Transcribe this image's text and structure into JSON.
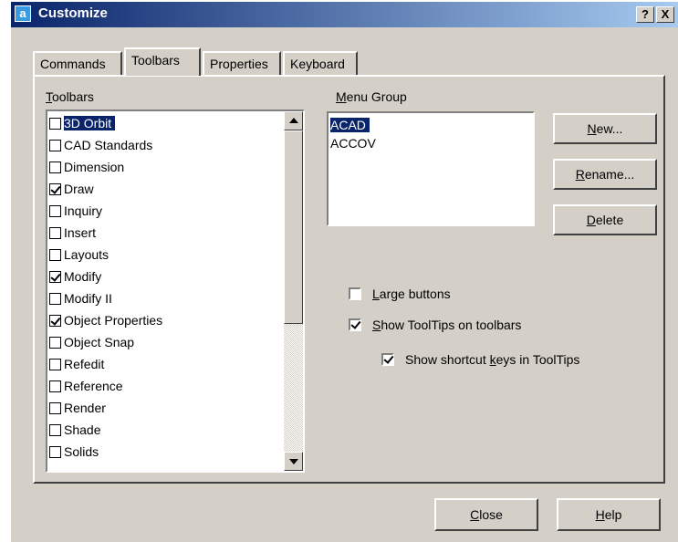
{
  "window": {
    "title": "Customize",
    "app_icon_glyph": "a",
    "help_glyph": "?",
    "close_glyph": "X"
  },
  "tabs": [
    {
      "label": "Commands",
      "active": false
    },
    {
      "label": "Toolbars",
      "active": true
    },
    {
      "label": "Properties",
      "active": false
    },
    {
      "label": "Keyboard",
      "active": false
    }
  ],
  "toolbars": {
    "label_key": "T",
    "label_rest": "oolbars",
    "items": [
      {
        "label": "3D Orbit",
        "checked": false,
        "selected": true
      },
      {
        "label": "CAD Standards",
        "checked": false,
        "selected": false
      },
      {
        "label": "Dimension",
        "checked": false,
        "selected": false
      },
      {
        "label": "Draw",
        "checked": true,
        "selected": false
      },
      {
        "label": "Inquiry",
        "checked": false,
        "selected": false
      },
      {
        "label": "Insert",
        "checked": false,
        "selected": false
      },
      {
        "label": "Layouts",
        "checked": false,
        "selected": false
      },
      {
        "label": "Modify",
        "checked": true,
        "selected": false
      },
      {
        "label": "Modify II",
        "checked": false,
        "selected": false
      },
      {
        "label": "Object Properties",
        "checked": true,
        "selected": false
      },
      {
        "label": "Object Snap",
        "checked": false,
        "selected": false
      },
      {
        "label": "Refedit",
        "checked": false,
        "selected": false
      },
      {
        "label": "Reference",
        "checked": false,
        "selected": false
      },
      {
        "label": "Render",
        "checked": false,
        "selected": false
      },
      {
        "label": "Shade",
        "checked": false,
        "selected": false
      },
      {
        "label": "Solids",
        "checked": false,
        "selected": false
      }
    ]
  },
  "menu_group": {
    "label_key": "M",
    "label_rest": "enu Group",
    "items": [
      {
        "label": "ACAD",
        "selected": true
      },
      {
        "label": "ACCOV",
        "selected": false
      }
    ]
  },
  "buttons": {
    "new": {
      "key": "N",
      "rest": "ew..."
    },
    "rename": {
      "key": "R",
      "rest": "ename..."
    },
    "delete": {
      "key": "D",
      "rest": "elete"
    },
    "close": {
      "key": "C",
      "rest": "lose"
    },
    "help": {
      "key": "H",
      "rest": "elp"
    }
  },
  "options": {
    "large_buttons": {
      "key": "L",
      "rest": "arge buttons",
      "checked": false
    },
    "show_tooltips": {
      "key": "S",
      "rest": "how ToolTips on toolbars",
      "checked": true
    },
    "show_shortcuts": {
      "before": "Show shortcut ",
      "key": "k",
      "rest": "eys in ToolTips",
      "checked": true
    }
  },
  "colors": {
    "title_start": "#0a246a",
    "title_end": "#a6caf0",
    "face": "#d4d0c8",
    "selection": "#0a246a"
  }
}
